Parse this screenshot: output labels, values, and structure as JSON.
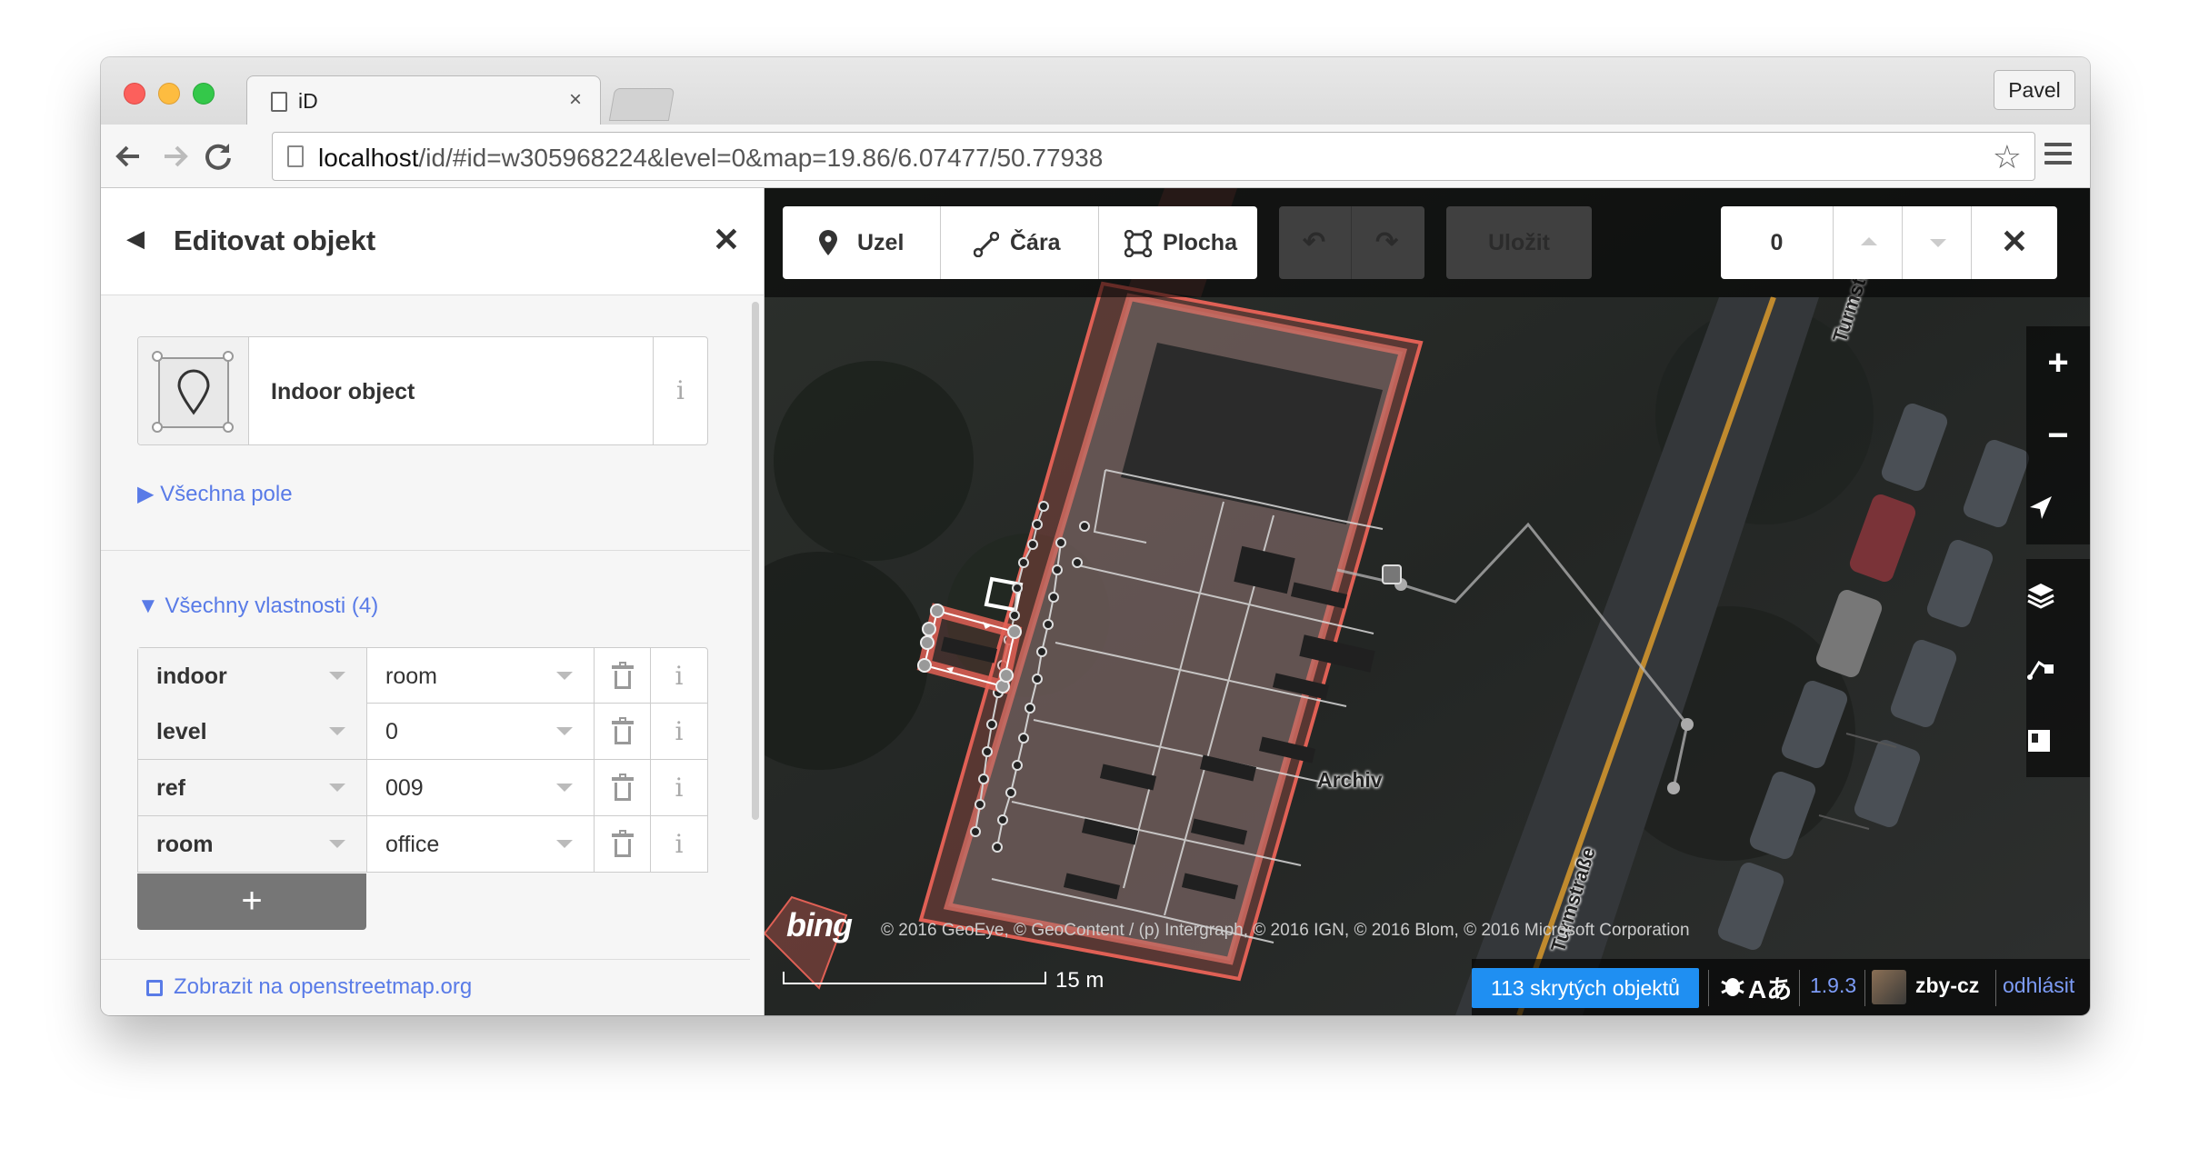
{
  "browser": {
    "tab_title": "iD",
    "tab_close": "×",
    "profile_name": "Pavel",
    "url_host": "localhost",
    "url_path": "/id/#id=w305968224&level=0&map=19.86/6.07477/50.77938"
  },
  "sidebar": {
    "back_glyph": "◀",
    "title": "Editovat objekt",
    "close_glyph": "✕",
    "preset_name": "Indoor object",
    "preset_info": "i",
    "all_fields_link": "▶ Všechna pole",
    "all_tags_link": "▼ Všechny vlastnosti (4)",
    "tags": [
      {
        "key": "indoor",
        "value": "room"
      },
      {
        "key": "level",
        "value": "0"
      },
      {
        "key": "ref",
        "value": "009"
      },
      {
        "key": "room",
        "value": "office"
      }
    ],
    "info_glyph": "i",
    "add_tag_glyph": "+",
    "osm_link": "Zobrazit na openstreetmap.org"
  },
  "map": {
    "modes": {
      "point": "Uzel",
      "line": "Čára",
      "area": "Plocha"
    },
    "save_label": "Uložit",
    "level_value": "0",
    "level_close": "✕",
    "zoom_in": "+",
    "zoom_out": "−",
    "bing_logo": "bing",
    "attribution": "© 2016 GeoEye, © GeoContent / (p) Intergraph, © 2016 IGN, © 2016 Blom, © 2016 Microsoft Corporation",
    "scale_label": "15 m",
    "room_label": "Archiv",
    "street_label": "Turmstraße",
    "street_label_top": "Turmstr"
  },
  "footer": {
    "hidden_objects": "113 skrytých objektů",
    "icons_text": "Aあ",
    "version": "1.9.3",
    "username": "zby-cz",
    "logout": "odhlásit"
  },
  "colors": {
    "accent_blue": "#597be7",
    "selection_red": "#e06055",
    "badge_blue": "#1f8ff2"
  }
}
